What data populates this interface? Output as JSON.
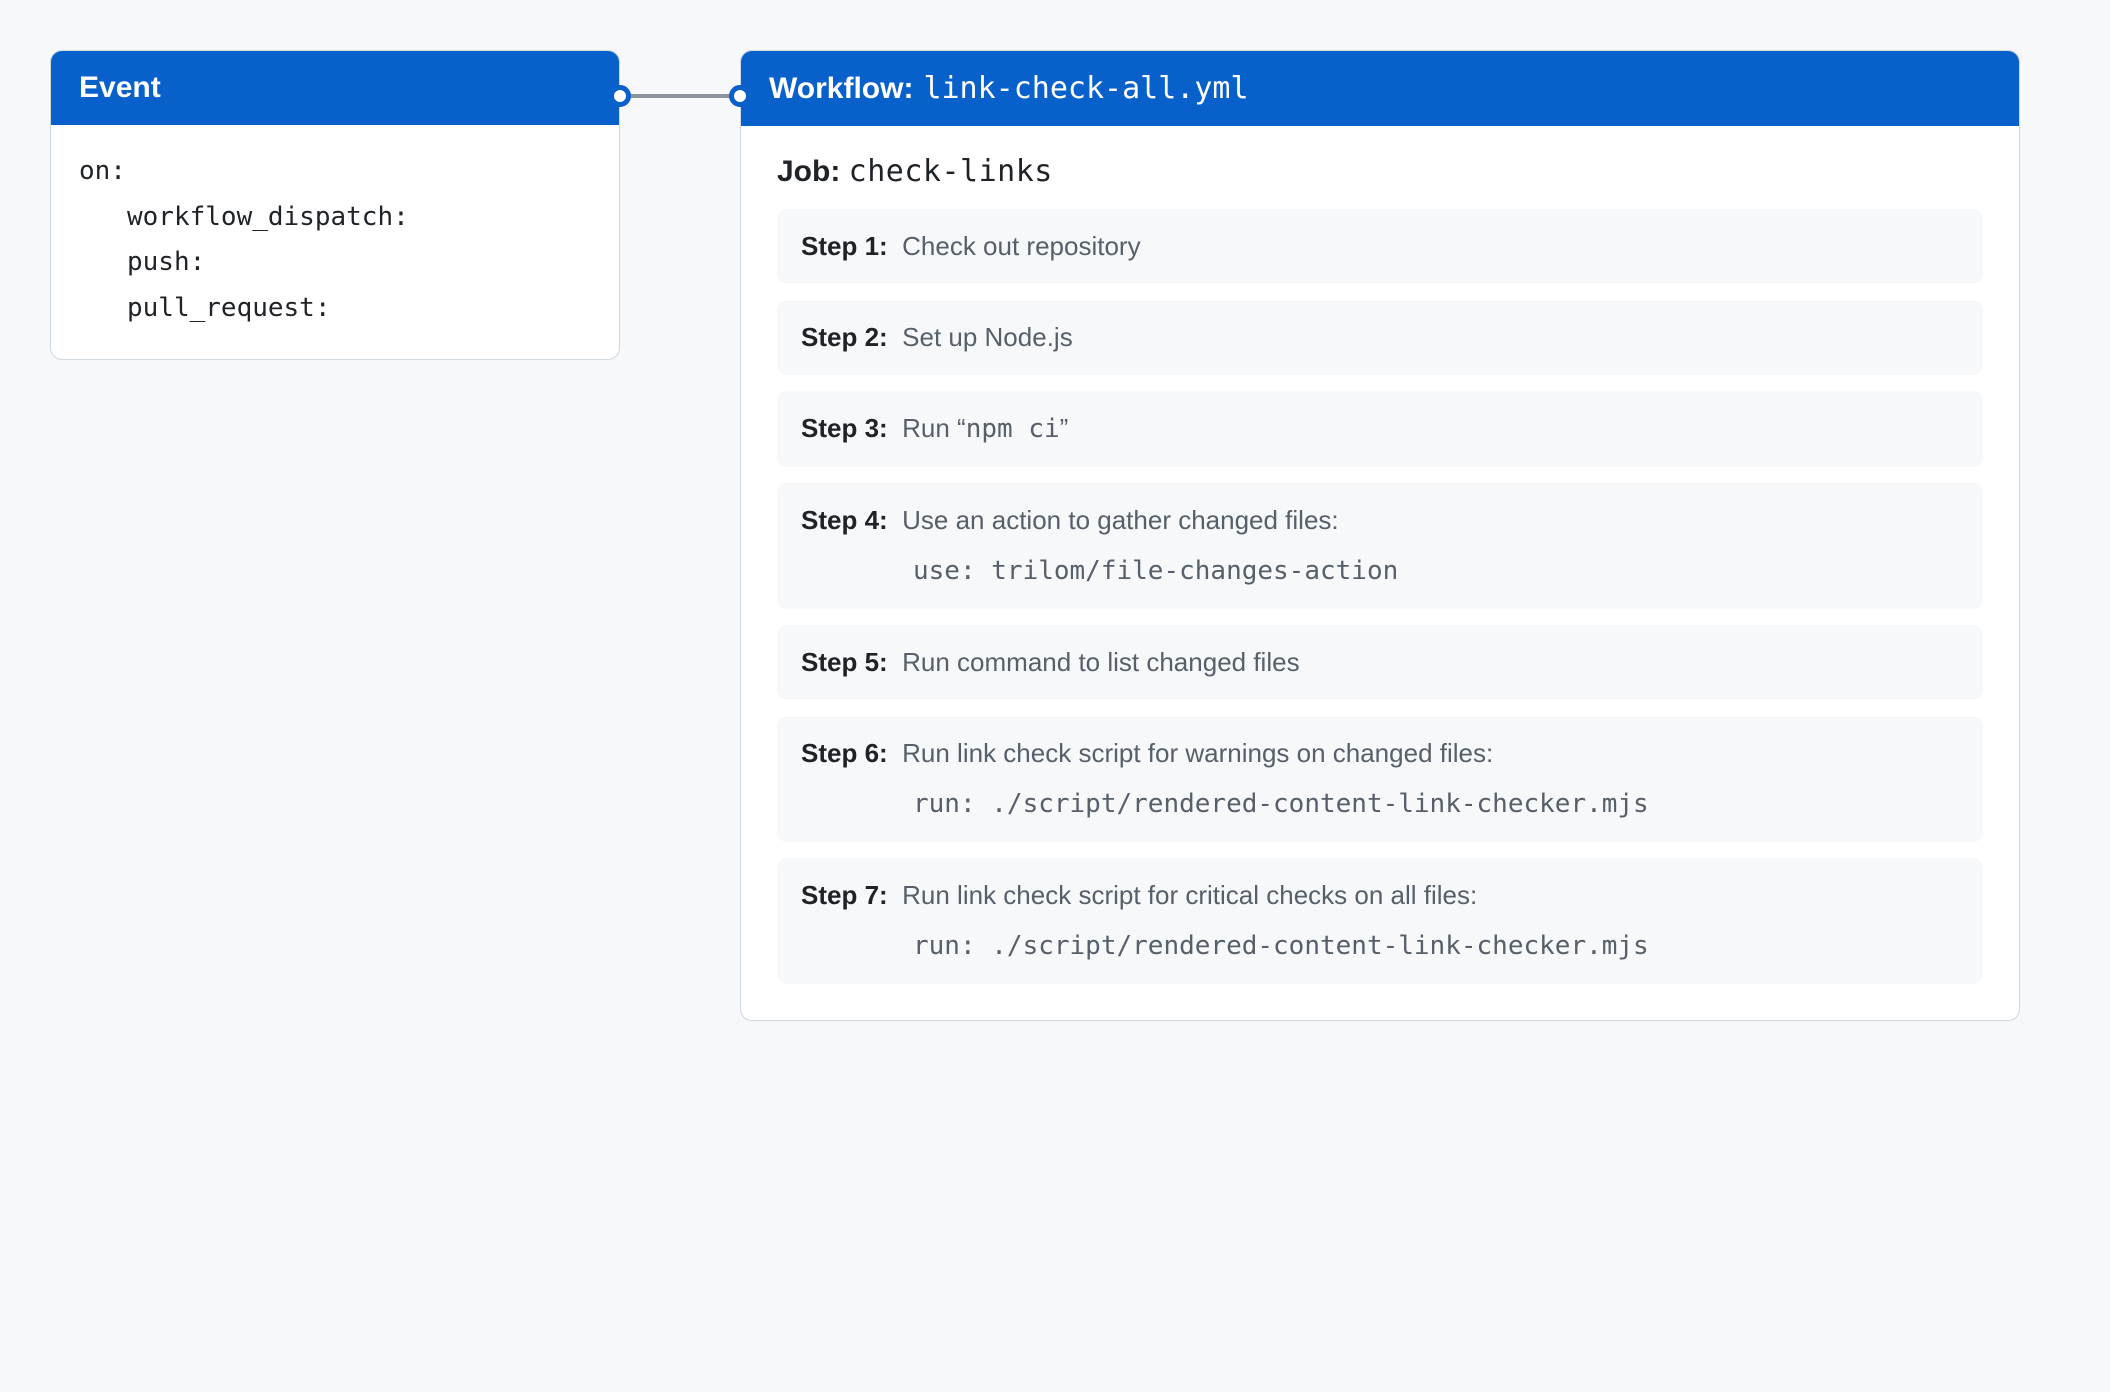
{
  "event": {
    "header": "Event",
    "on_label": "on:",
    "triggers": [
      "workflow_dispatch:",
      "push:",
      "pull_request:"
    ]
  },
  "workflow": {
    "header_label": "Workflow:",
    "filename": "link-check-all.yml",
    "job_label": "Job:",
    "job_name": "check-links",
    "steps": [
      {
        "label": "Step 1:",
        "text_pre": "Check out repository",
        "mono": "",
        "text_post": "",
        "detail": ""
      },
      {
        "label": "Step 2:",
        "text_pre": "Set up Node.js",
        "mono": "",
        "text_post": "",
        "detail": ""
      },
      {
        "label": "Step 3:",
        "text_pre": "Run “",
        "mono": "npm ci",
        "text_post": "”",
        "detail": ""
      },
      {
        "label": "Step 4:",
        "text_pre": "Use an action to gather changed files:",
        "mono": "",
        "text_post": "",
        "detail": "use: trilom/file-changes-action"
      },
      {
        "label": "Step 5:",
        "text_pre": "Run command to list changed files",
        "mono": "",
        "text_post": "",
        "detail": ""
      },
      {
        "label": "Step 6:",
        "text_pre": "Run link check script for warnings on changed files:",
        "mono": "",
        "text_post": "",
        "detail": "run: ./script/rendered-content-link-checker.mjs"
      },
      {
        "label": "Step 7:",
        "text_pre": "Run link check script for critical checks on all files:",
        "mono": "",
        "text_post": "",
        "detail": "run: ./script/rendered-content-link-checker.mjs"
      }
    ]
  }
}
